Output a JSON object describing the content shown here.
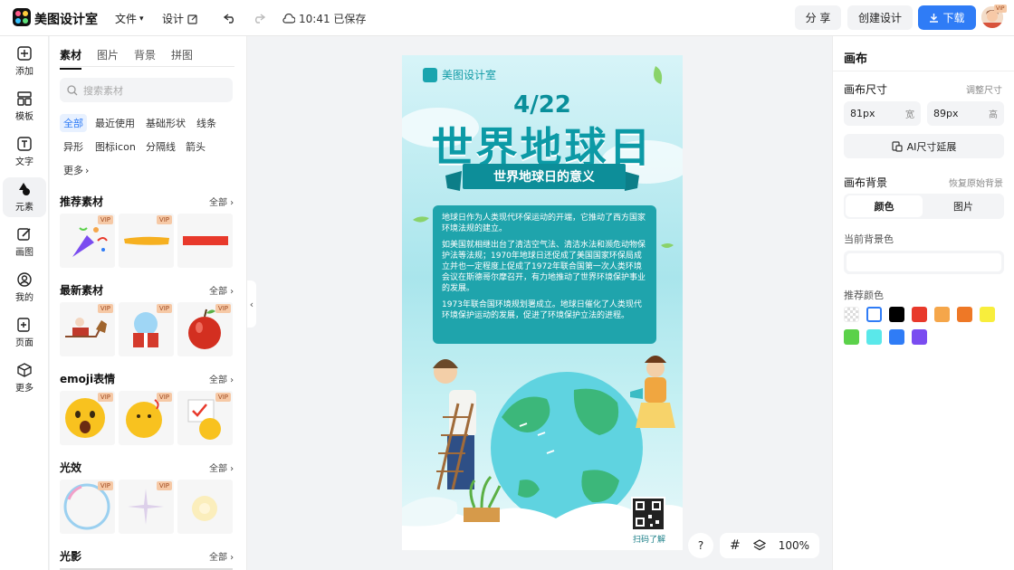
{
  "topbar": {
    "brand": "美图设计室",
    "menu_file": "文件",
    "menu_design": "设计",
    "saved_status": "10:41 已保存",
    "share": "分 享",
    "create_design": "创建设计",
    "download": "下载",
    "avatar_badge": "VIP"
  },
  "rail": [
    {
      "label": "添加",
      "icon": "plus-square-icon"
    },
    {
      "label": "模板",
      "icon": "template-icon"
    },
    {
      "label": "文字",
      "icon": "text-icon"
    },
    {
      "label": "元素",
      "icon": "shapes-icon"
    },
    {
      "label": "画图",
      "icon": "pencil-icon"
    },
    {
      "label": "我的",
      "icon": "user-icon"
    },
    {
      "label": "页面",
      "icon": "page-add-icon"
    },
    {
      "label": "更多",
      "icon": "cube-icon"
    }
  ],
  "panel": {
    "tabs": [
      "素材",
      "图片",
      "背景",
      "拼图"
    ],
    "search_placeholder": "搜索素材",
    "tags_row1": [
      "全部",
      "最近使用",
      "基础形状",
      "线条"
    ],
    "tags_row2": [
      "异形",
      "图标icon",
      "分隔线",
      "箭头"
    ],
    "tags_more": "更多",
    "sections": [
      {
        "title": "推荐素材",
        "all": "全部"
      },
      {
        "title": "最新素材",
        "all": "全部"
      },
      {
        "title": "emoji表情",
        "all": "全部"
      },
      {
        "title": "光效",
        "all": "全部"
      },
      {
        "title": "光影",
        "all": "全部"
      }
    ],
    "vip": "VIP"
  },
  "poster": {
    "brand": "美图设计室",
    "date": "4/22",
    "title": "世界地球日",
    "ribbon": "世界地球日的意义",
    "paragraphs": [
      "地球日作为人类现代环保运动的开端，它推动了西方国家环境法规的建立。",
      "如美国就相继出台了清洁空气法、清洁水法和濒危动物保护法等法规；1970年地球日还促成了美国国家环保局成立并也一定程度上促成了1972年联合国第一次人类环境会议在斯德哥尔摩召开，有力地推动了世界环境保护事业的发展。",
      "1973年联合国环境规划署成立。地球日催化了人类现代环境保护运动的发展，促进了环境保护立法的进程。"
    ],
    "qr_label": "扫码了解"
  },
  "bottom_tools": {
    "help": "?",
    "zoom": "100%"
  },
  "right_panel": {
    "title": "画布",
    "size_label": "画布尺寸",
    "size_adjust": "调整尺寸",
    "width_value": "81px",
    "width_unit": "宽",
    "height_value": "89px",
    "height_unit": "高",
    "ai_expand": "AI尺寸延展",
    "bg_label": "画布背景",
    "bg_restore": "恢复原始背景",
    "seg_color": "颜色",
    "seg_image": "图片",
    "current_bg_label": "当前背景色",
    "recommend_label": "推荐颜色",
    "colors": [
      "transparent",
      "#ffffff",
      "#000000",
      "#e8392b",
      "#f5a64a",
      "#ee7826",
      "#f8ee3c",
      "#5bd14a",
      "#5ae8ea",
      "#2f7cf6",
      "#7a4cf0"
    ]
  }
}
